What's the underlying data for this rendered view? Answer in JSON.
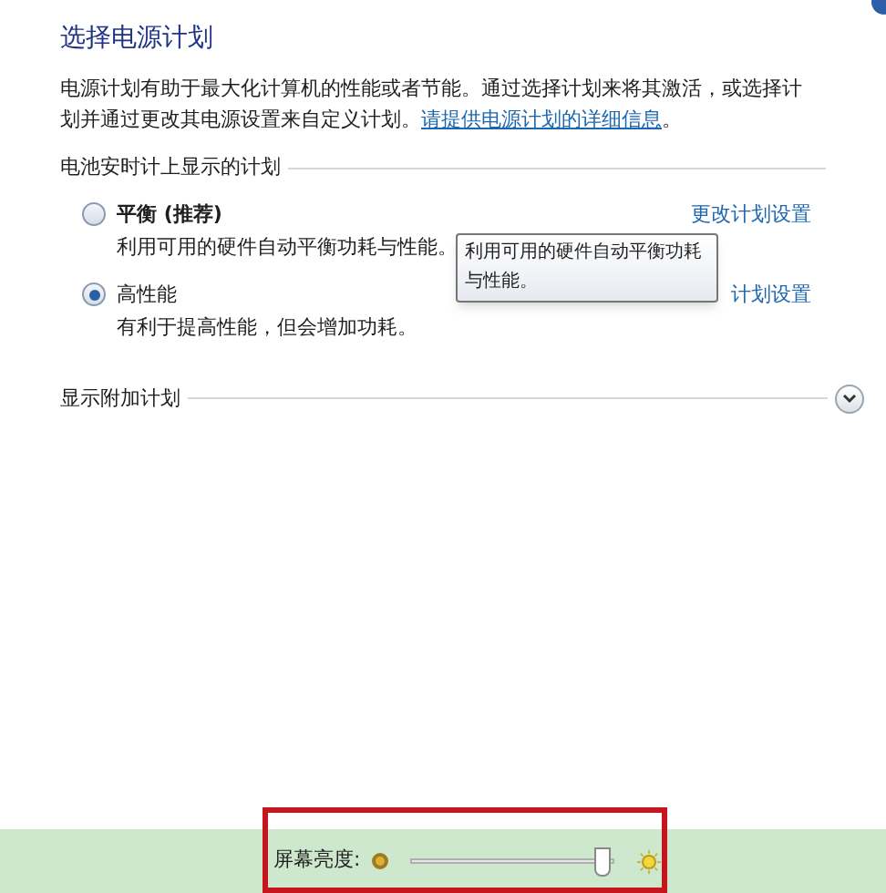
{
  "title": "选择电源计划",
  "description": {
    "text": "电源计划有助于最大化计算机的性能或者节能。通过选择计划来将其激活，或选择计划并通过更改其电源设置来自定义计划。",
    "link": "请提供电源计划的详细信息",
    "end": "。"
  },
  "section": "电池安时计上显示的计划",
  "plans": [
    {
      "name": "平衡 (推荐)",
      "description": "利用可用的硬件自动平衡功耗与性能。",
      "selected": false,
      "link": "更改计划设置"
    },
    {
      "name": "高性能",
      "description": "有利于提高性能，但会增加功耗。",
      "selected": true,
      "link": "计划设置"
    }
  ],
  "tooltip": "利用可用的硬件自动平衡功耗与性能。",
  "more_plans": {
    "label": "显示附加计划",
    "expanded": false
  },
  "brightness": {
    "label": "屏幕亮度:",
    "level": 0.95
  }
}
